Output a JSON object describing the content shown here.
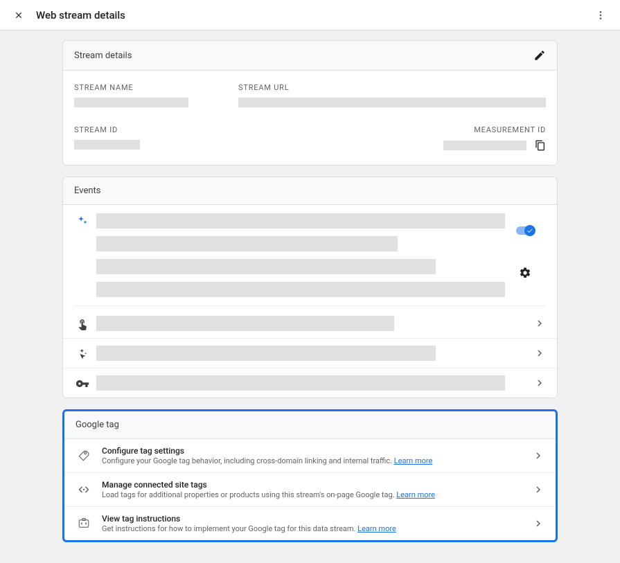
{
  "header": {
    "title": "Web stream details"
  },
  "stream_details": {
    "heading": "Stream details",
    "stream_name_label": "STREAM NAME",
    "stream_url_label": "STREAM URL",
    "stream_id_label": "STREAM ID",
    "measurement_id_label": "MEASUREMENT ID"
  },
  "events": {
    "heading": "Events"
  },
  "google_tag": {
    "heading": "Google tag",
    "rows": [
      {
        "title": "Configure tag settings",
        "desc": "Configure your Google tag behavior, including cross-domain linking and internal traffic. ",
        "learn": "Learn more"
      },
      {
        "title": "Manage connected site tags",
        "desc": "Load tags for additional properties or products using this stream's on-page Google tag. ",
        "learn": "Learn more"
      },
      {
        "title": "View tag instructions",
        "desc": "Get instructions for how to implement your Google tag for this data stream. ",
        "learn": "Learn more"
      }
    ]
  }
}
